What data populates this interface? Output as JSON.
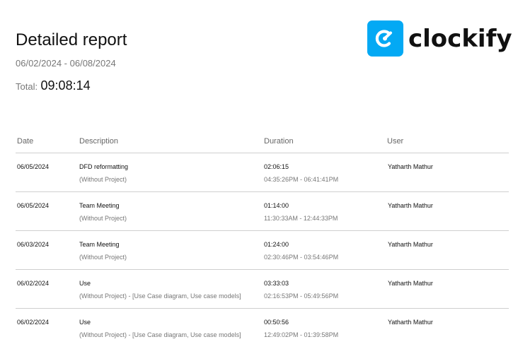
{
  "report": {
    "title": "Detailed report",
    "date_range": "06/02/2024 - 06/08/2024",
    "total_label": "Total:",
    "total_value": "09:08:14"
  },
  "brand": {
    "name": "clockify",
    "accent": "#03a9f4"
  },
  "table": {
    "headers": {
      "date": "Date",
      "description": "Description",
      "duration": "Duration",
      "user": "User"
    },
    "rows": [
      {
        "date": "06/05/2024",
        "description": "DFD reformatting",
        "project": "(Without Project)",
        "duration": "02:06:15",
        "time_range": "04:35:26PM - 06:41:41PM",
        "user": "Yatharth Mathur"
      },
      {
        "date": "06/05/2024",
        "description": "Team Meeting",
        "project": "(Without Project)",
        "duration": "01:14:00",
        "time_range": "11:30:33AM - 12:44:33PM",
        "user": "Yatharth Mathur"
      },
      {
        "date": "06/03/2024",
        "description": "Team Meeting",
        "project": "(Without Project)",
        "duration": "01:24:00",
        "time_range": "02:30:46PM - 03:54:46PM",
        "user": "Yatharth Mathur"
      },
      {
        "date": "06/02/2024",
        "description": "Use",
        "project": "(Without Project) - [Use Case diagram, Use case models]",
        "duration": "03:33:03",
        "time_range": "02:16:53PM - 05:49:56PM",
        "user": "Yatharth Mathur"
      },
      {
        "date": "06/02/2024",
        "description": "Use",
        "project": "(Without Project) - [Use Case diagram, Use case models]",
        "duration": "00:50:56",
        "time_range": "12:49:02PM - 01:39:58PM",
        "user": "Yatharth Mathur"
      }
    ]
  }
}
